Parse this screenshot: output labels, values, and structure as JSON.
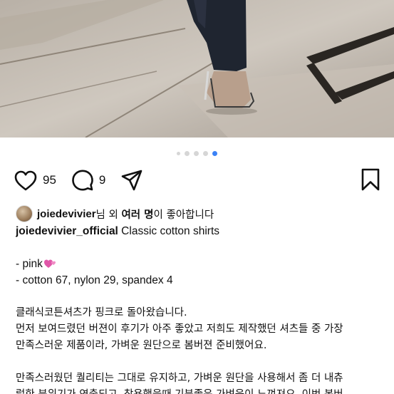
{
  "post": {
    "pagination": {
      "count": 5,
      "active_index": 4
    },
    "likes_count": "95",
    "comments_count": "9",
    "liked_by": {
      "user": "joiedevivier",
      "suffix_1": "님 외 ",
      "bold": "여러 명",
      "suffix_2": "이 좋아합니다"
    },
    "author": "joiedevivier_official",
    "caption_title": " Classic cotton shirts",
    "details": [
      "- pink",
      "- cotton 67, nylon 29, spandex 4"
    ],
    "body_lines": [
      "클래식코튼셔츠가 핑크로 돌아왔습니다.",
      "먼저 보여드렸던 버젼이 후기가 아주 좋았고 저희도 제작했던 셔츠들 중 가장",
      "만족스러운 제품이라, 가벼운 원단으로 봄버젼 준비했어요."
    ],
    "body_lines_2": [
      "만족스러웠던 퀄리티는 그대로 유지하고, 가벼운 원단을 사용해서 좀 더 내츄",
      "럴한 분위기가 연출되고, 착용했을때 기분좋은 가벼움이 느껴져요. 이번 봄버"
    ]
  },
  "colors": {
    "accent": "#3b82f6",
    "heart_emoji": "#e056a8"
  }
}
